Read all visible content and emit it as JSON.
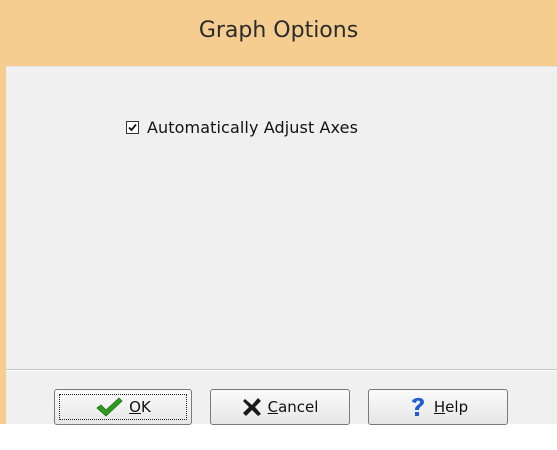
{
  "dialog": {
    "title": "Graph Options"
  },
  "options": {
    "auto_adjust_axes": {
      "label": "Automatically Adjust Axes",
      "checked": true
    }
  },
  "buttons": {
    "ok": {
      "label": "OK",
      "icon": "checkmark-icon"
    },
    "cancel": {
      "label": "Cancel",
      "icon": "x-icon"
    },
    "help": {
      "label": "Help",
      "icon": "question-mark-icon"
    }
  },
  "colors": {
    "title_bar": "#f5cd91",
    "content_bg": "#f0f0f0",
    "ok_icon": "#2e9b1f",
    "cancel_icon": "#1a1a1a",
    "help_icon": "#1f5fd6"
  }
}
